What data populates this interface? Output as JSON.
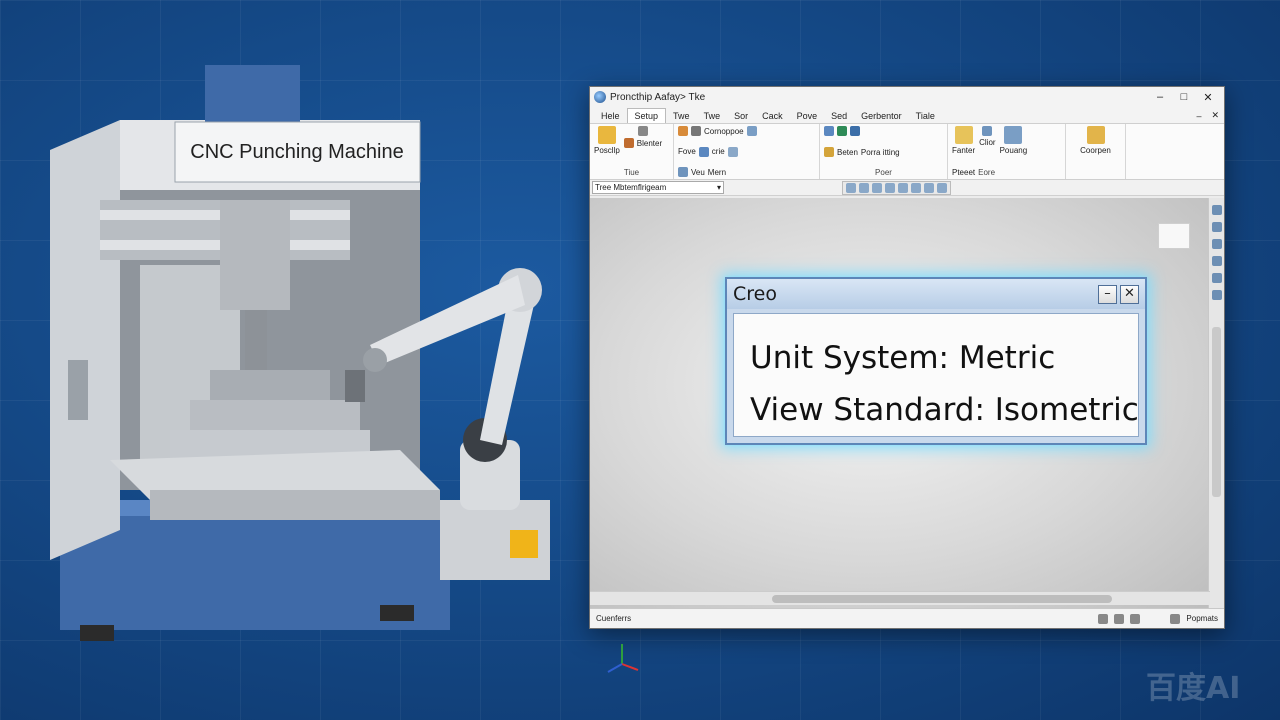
{
  "illustration": {
    "machine_sign": "CNC Punching Machine"
  },
  "window": {
    "title": "Proncthip Aafay> Tke",
    "minimize": "–",
    "maximize": "□",
    "close": "✕",
    "menu_tabs": [
      {
        "label": "Hele",
        "active": false
      },
      {
        "label": "Setup",
        "active": true
      },
      {
        "label": "Twe",
        "active": false
      },
      {
        "label": "Twe",
        "active": false
      },
      {
        "label": "Sor",
        "active": false
      },
      {
        "label": "Cack",
        "active": false
      },
      {
        "label": "Pove",
        "active": false
      },
      {
        "label": "Sed",
        "active": false
      },
      {
        "label": "Gerbentor",
        "active": false
      },
      {
        "label": "Tiale",
        "active": false
      }
    ]
  },
  "ribbon": {
    "g1_big": "Poscllp",
    "g1_a": "Blenter",
    "g1_label": "Tiue",
    "g2_a": "Cornoppoe",
    "g2_b": "Fove",
    "g2_c": "crie",
    "g2_d": "Veu",
    "g2_e": "Mern",
    "g3_a": "Beten",
    "g3_b": "Porra itting",
    "g3_label": "Poer",
    "g4_a": "Fanter",
    "g4_b": "Clior",
    "g4_c": "Pouang",
    "g4_d": "Pteeet",
    "g4_label": "Eore",
    "g5_a": "Coorpen"
  },
  "toolbar": {
    "tree_select": "Tree Mbtemflrigeam"
  },
  "dialog": {
    "title": "Creo",
    "minimize": "–",
    "close": "✕",
    "line1": "Unit System: Metric",
    "line2": "View Standard: Isometric"
  },
  "status": {
    "left": "Cuenferrs",
    "right": "Popmats"
  },
  "watermark": "百度AI"
}
